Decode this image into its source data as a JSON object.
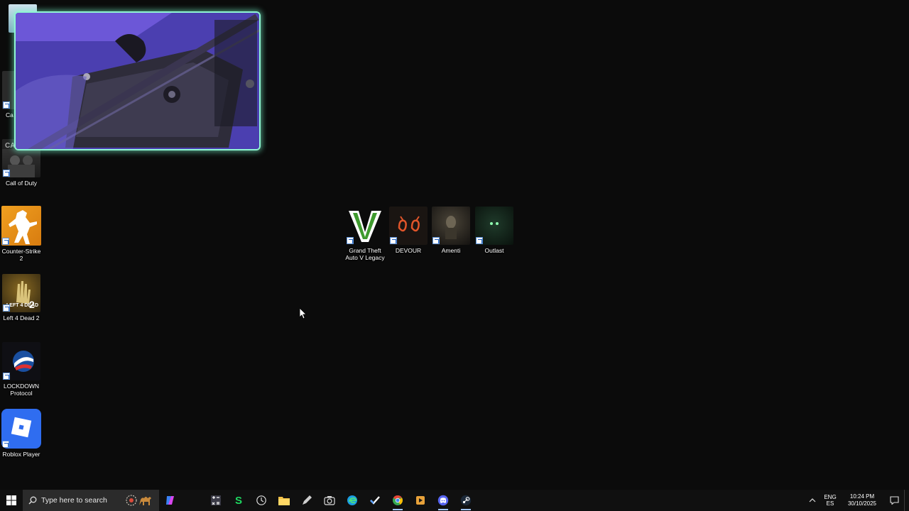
{
  "desktop_icons_left": [
    {
      "label": "Call of Duty",
      "icon": "call-of-duty-icon"
    },
    {
      "label": "Counter-Strike 2",
      "icon": "counter-strike-icon"
    },
    {
      "label": "Left 4 Dead 2",
      "icon": "left4dead-icon"
    },
    {
      "label": "LOCKDOWN Protocol",
      "icon": "lockdown-icon"
    },
    {
      "label": "Roblox Player",
      "icon": "roblox-icon"
    }
  ],
  "partial_icon": {
    "label": "Ca Un"
  },
  "desktop_icons_center": [
    {
      "label": "Grand Theft Auto V Legacy",
      "icon": "gta-v-icon"
    },
    {
      "label": "DEVOUR",
      "icon": "devour-icon"
    },
    {
      "label": "Amenti",
      "icon": "amenti-icon"
    },
    {
      "label": "Outlast",
      "icon": "outlast-icon"
    }
  ],
  "taskbar": {
    "search_placeholder": "Type here to search",
    "apps": [
      "copilot-icon",
      "calculator-icon",
      "spotify-s-icon",
      "clock-app-icon",
      "file-explorer-icon",
      "pen-icon",
      "camera-icon",
      "edge-icon",
      "todo-check-icon",
      "chrome-icon",
      "media-player-icon",
      "discord-icon",
      "steam-icon"
    ]
  },
  "tray": {
    "lang_top": "ENG",
    "lang_bottom": "ES",
    "time": "10:24 PM",
    "date": "30/10/2025"
  },
  "colors": {
    "desktop_bg": "#0b0b0b",
    "webcam_border": "#8ff5d2",
    "taskbar_bg": "#101010"
  }
}
